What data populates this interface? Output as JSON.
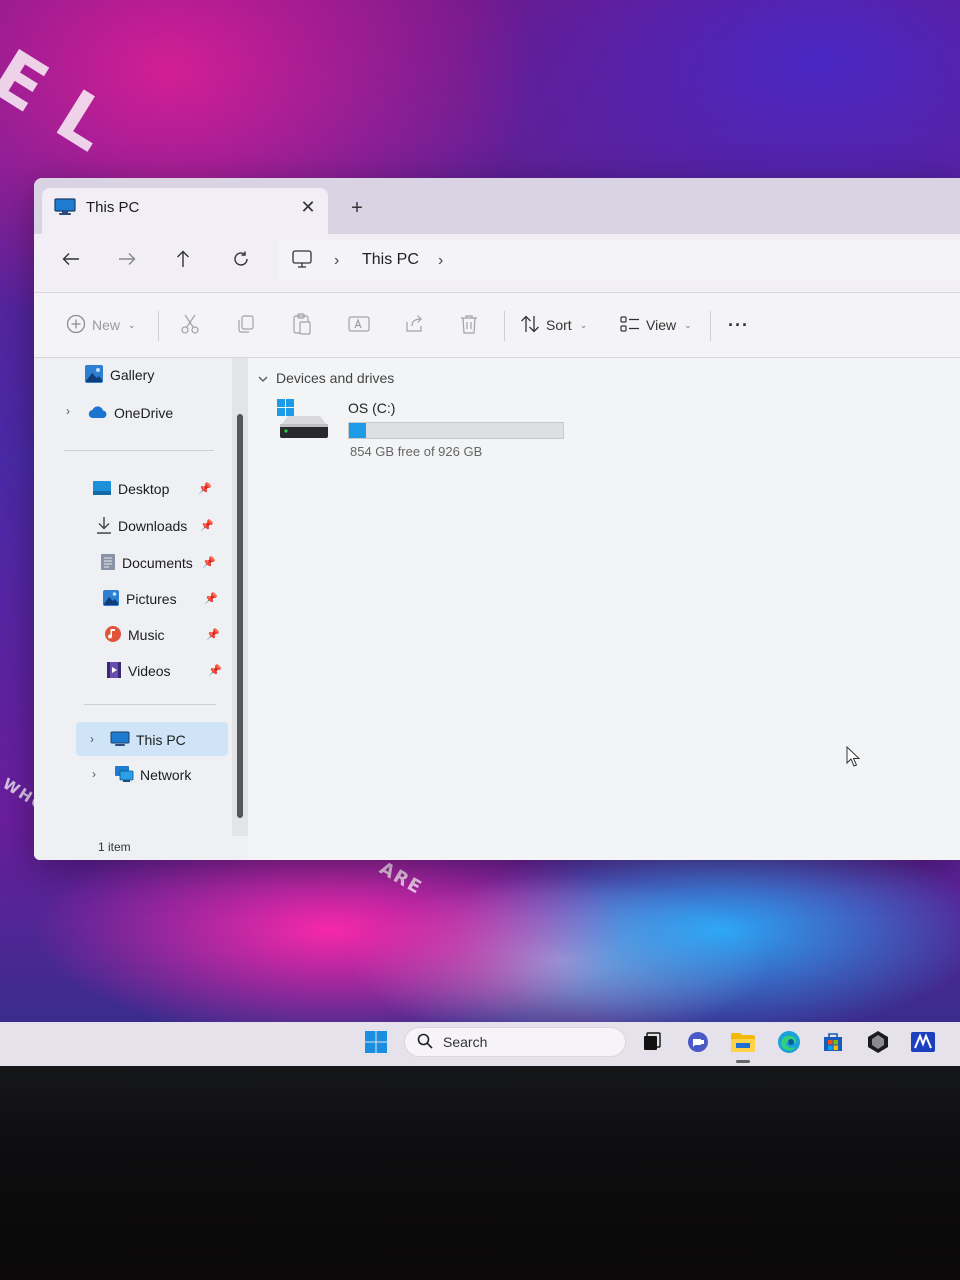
{
  "window": {
    "tab_title": "This PC",
    "tab_close": "✕",
    "new_tab": "+"
  },
  "address_bar": {
    "segment": "This PC",
    "chevron": "›"
  },
  "toolbar": {
    "new_label": "New",
    "sort_label": "Sort",
    "view_label": "View",
    "more_label": "···"
  },
  "sidebar": {
    "gallery": "Gallery",
    "onedrive": "OneDrive",
    "quick_access": [
      {
        "label": "Desktop",
        "icon": "desktop-icon"
      },
      {
        "label": "Downloads",
        "icon": "downloads-icon"
      },
      {
        "label": "Documents",
        "icon": "documents-icon"
      },
      {
        "label": "Pictures",
        "icon": "pictures-icon"
      },
      {
        "label": "Music",
        "icon": "music-icon"
      },
      {
        "label": "Videos",
        "icon": "videos-icon"
      }
    ],
    "this_pc": "This PC",
    "network": "Network"
  },
  "content": {
    "group_header": "Devices and drives",
    "drives": [
      {
        "name": "OS (C:)",
        "free_text": "854 GB free of 926 GB",
        "used_fraction": 0.078
      }
    ]
  },
  "status_bar": {
    "item_count": "1 item"
  },
  "taskbar": {
    "search_label": "Search"
  },
  "colors": {
    "accent": "#1e9be6",
    "selection": "#cfe4f6",
    "titlebar": "#dad3e3"
  }
}
